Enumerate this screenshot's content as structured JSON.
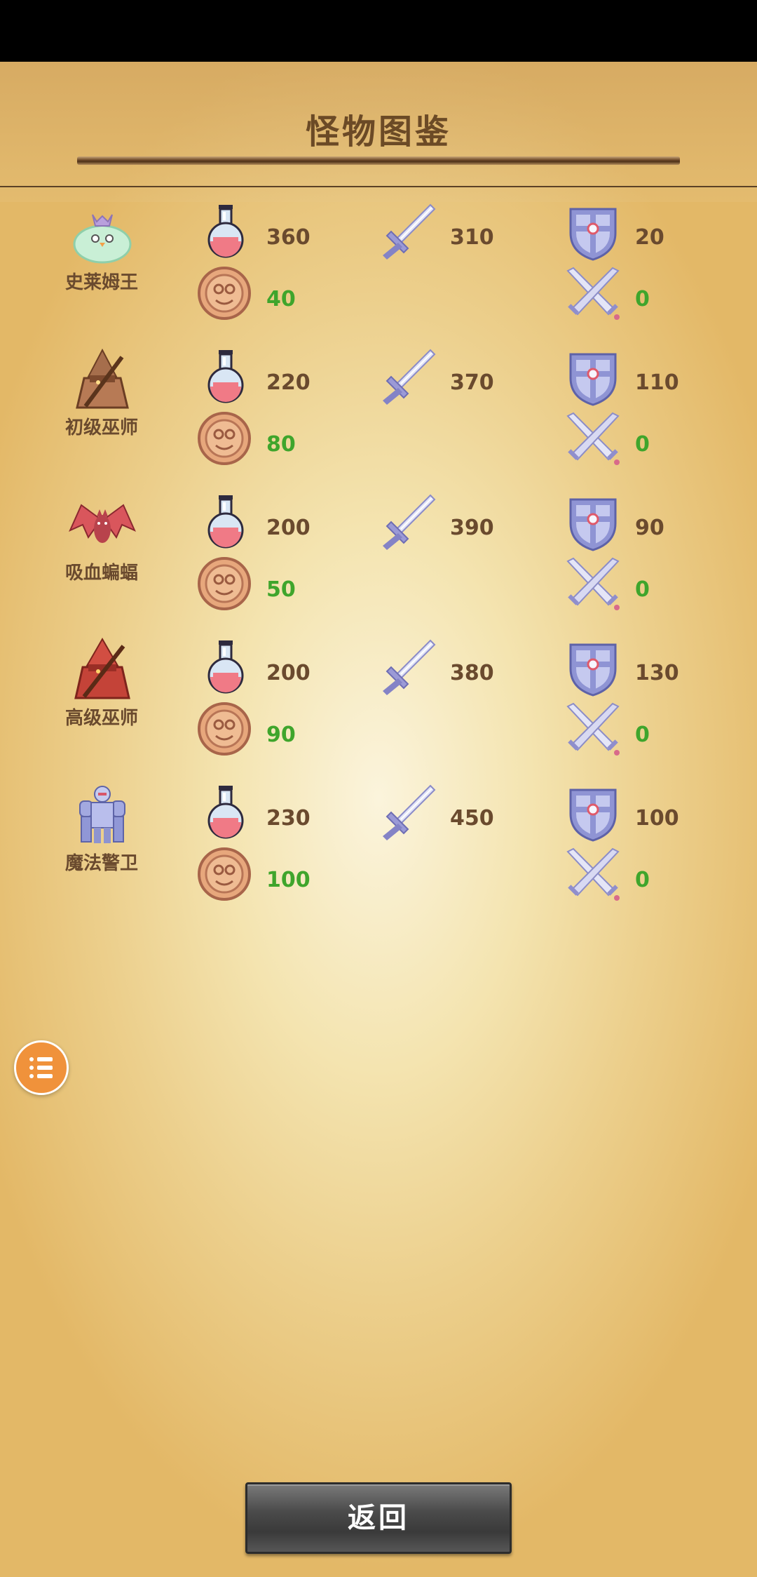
{
  "header": {
    "title": "怪物图鉴"
  },
  "monsters": [
    {
      "name": "史莱姆王",
      "portrait": "slime-king",
      "hp": "360",
      "atk": "310",
      "def": "20",
      "gold": "40",
      "hits": "0"
    },
    {
      "name": "初级巫师",
      "portrait": "junior-wizard",
      "hp": "220",
      "atk": "370",
      "def": "110",
      "gold": "80",
      "hits": "0"
    },
    {
      "name": "吸血蝙蝠",
      "portrait": "vampire-bat",
      "hp": "200",
      "atk": "390",
      "def": "90",
      "gold": "50",
      "hits": "0"
    },
    {
      "name": "高级巫师",
      "portrait": "senior-wizard",
      "hp": "200",
      "atk": "380",
      "def": "130",
      "gold": "90",
      "hits": "0"
    },
    {
      "name": "魔法警卫",
      "portrait": "magic-guard",
      "hp": "230",
      "atk": "450",
      "def": "100",
      "gold": "100",
      "hits": "0"
    }
  ],
  "icons": {
    "hp": "potion-icon",
    "atk": "sword-icon",
    "def": "shield-icon",
    "gold": "coin-icon",
    "hits": "crossed-swords-icon",
    "menu": "list-menu-icon"
  },
  "footer": {
    "back_label": "返回"
  },
  "colors": {
    "text_brown": "#6a4a2e",
    "gold_green": "#3fa52c",
    "fab_orange": "#f0923b"
  }
}
